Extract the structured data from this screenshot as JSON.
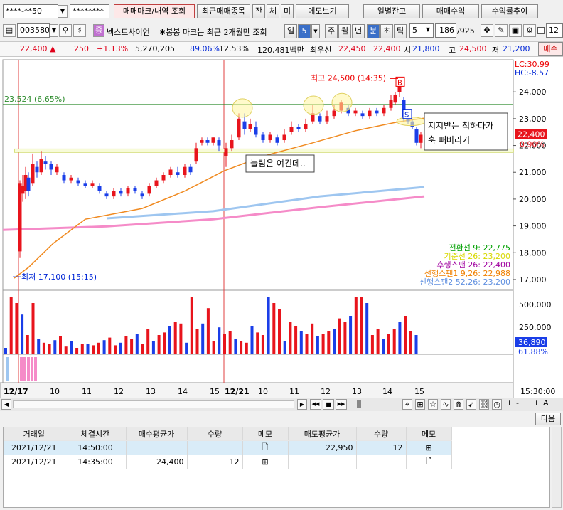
{
  "toolbar1": {
    "account_mask": "****-**50",
    "password_mask": "********",
    "trade_mark_btn": "매매마크/내역 조회",
    "recent_stocks_btn": "최근매매종목",
    "small_btns": [
      "잔",
      "체",
      "미"
    ],
    "memo_btn": "메모보기",
    "daily_balance_btn": "일별잔고",
    "trade_profit_btn": "매매수익",
    "return_trend_btn": "수익률추이"
  },
  "toolbar2": {
    "stock_code": "003580",
    "stock_name": "넥스트사이언",
    "notice": "봉봉 마크는 최근 2개월만 조회",
    "period_tabs": [
      "일",
      "5",
      "주",
      "월",
      "년",
      "분",
      "초",
      "틱"
    ],
    "interval_value": "5",
    "count_value": "186",
    "count_total": "/925",
    "right_field": "12"
  },
  "quote_bar": {
    "price": "22,400",
    "change": "250",
    "change_pct": "+1.13%",
    "volume": "5,270,205",
    "vol_ratio": "89.06%",
    "turnover": "12.53%",
    "amount": "120,481백만",
    "best_label": "최우선",
    "ask": "22,450",
    "bid": "22,400",
    "open_label": "시",
    "open": "21,800",
    "high_label": "고",
    "high": "24,500",
    "low_label": "저",
    "low": "21,200",
    "buy_label": "매수"
  },
  "chart_data": {
    "type": "candlestick",
    "x_ticks": [
      "12/17",
      "10",
      "11",
      "12",
      "13",
      "14",
      "15",
      "12/21",
      "10",
      "11",
      "12",
      "13",
      "14",
      "15"
    ],
    "price_ticks": [
      "24,000",
      "23,000",
      "22,000",
      "21,000",
      "20,000",
      "19,000",
      "18,000",
      "17,000"
    ],
    "volume_ticks": [
      "500,000",
      "250,000"
    ],
    "ylim": [
      16600,
      25200
    ],
    "top_left_label": "23,524 (6.65%)",
    "lc_label": "LC:30.99",
    "hc_label": "HC:-8.57",
    "current_price_tag": "22,400",
    "current_pct_tag": "0.90%",
    "volume_tag": "36,890",
    "volume_pct_tag": "61.88%",
    "time_label": "15:30:00",
    "high_annotation": "최고 24,500 (14:35)",
    "low_annotation": "최저 17,100 (15:15)",
    "buy_mark": "B",
    "sell_mark": "S",
    "legend": [
      {
        "text": "전환선 9: 22,775",
        "color": "#00a000"
      },
      {
        "text": "기준선 26: 23,200",
        "color": "#d8d800"
      },
      {
        "text": "후행스팬 26: 22,400",
        "color": "#a000a0"
      },
      {
        "text": "선행스팬1 9,26: 22,988",
        "color": "#f08000"
      },
      {
        "text": "선행스팬2 52,26: 23,200",
        "color": "#6090e0"
      }
    ],
    "reference_lines": {
      "green": 23524,
      "yellow_band": [
        21750,
        21870
      ]
    },
    "notes": [
      "눌림은 여긴데..",
      "지지받는 척하다가 훅 빼버리기"
    ]
  },
  "scroll_controls": [
    "◀",
    "▶",
    "◀◀",
    "■",
    "▶▶",
    "+",
    "-",
    "+",
    "A"
  ],
  "next_btn": "다음",
  "trade_table": {
    "headers": [
      "거래일",
      "체결시간",
      "매수평균가",
      "수량",
      "메모",
      "매도평균가",
      "수량",
      "메모"
    ],
    "rows": [
      [
        "2021/12/21",
        "14:50:00",
        "",
        "",
        "",
        "22,950",
        "12",
        ""
      ],
      [
        "2021/12/21",
        "14:35:00",
        "24,400",
        "12",
        "",
        "",
        "",
        ""
      ]
    ]
  }
}
